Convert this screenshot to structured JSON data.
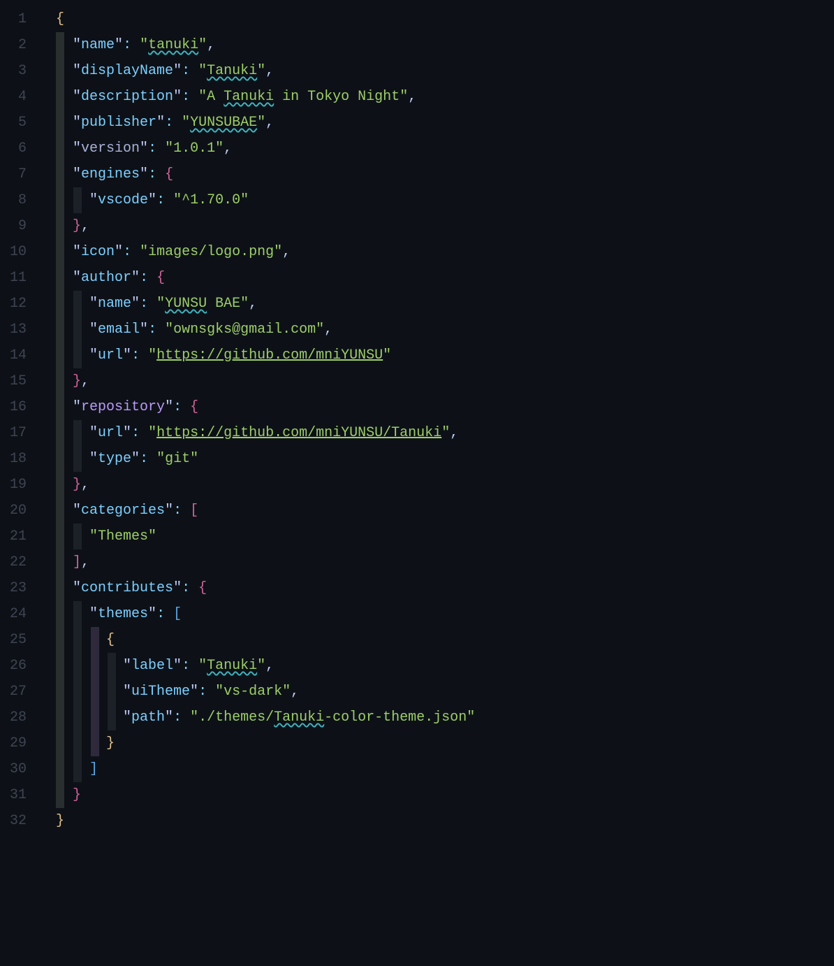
{
  "lineNumbers": [
    "1",
    "2",
    "3",
    "4",
    "5",
    "6",
    "7",
    "8",
    "9",
    "10",
    "11",
    "12",
    "13",
    "14",
    "15",
    "16",
    "17",
    "18",
    "19",
    "20",
    "21",
    "22",
    "23",
    "24",
    "25",
    "26",
    "27",
    "28",
    "29",
    "30",
    "31",
    "32"
  ],
  "code": {
    "name_key": "name",
    "name_val": "tanuki",
    "displayName_key": "displayName",
    "displayName_val": "Tanuki",
    "description_key": "description",
    "description_pre": "A ",
    "description_wavy": "Tanuki",
    "description_post": " in Tokyo Night",
    "publisher_key": "publisher",
    "publisher_val": "YUNSUBAE",
    "version_key": "version",
    "version_val": "1.0.1",
    "engines_key": "engines",
    "vscode_key": "vscode",
    "vscode_val": "^1.70.0",
    "icon_key": "icon",
    "icon_val": "images/logo.png",
    "author_key": "author",
    "author_name_key": "name",
    "author_name_pre": "YUNSU",
    "author_name_post": " BAE",
    "email_key": "email",
    "email_val": "ownsgks@gmail.com",
    "url_key": "url",
    "author_url_val": "https://github.com/mniYUNSU",
    "repository_key": "repository",
    "repo_url_val": "https://github.com/mniYUNSU/Tanuki",
    "type_key": "type",
    "type_val": "git",
    "categories_key": "categories",
    "categories_item": "Themes",
    "contributes_key": "contributes",
    "themes_key": "themes",
    "label_key": "label",
    "label_val": "Tanuki",
    "uiTheme_key": "uiTheme",
    "uiTheme_val": "vs-dark",
    "path_key": "path",
    "path_pre": "./themes/",
    "path_wavy": "Tanuki",
    "path_post": "-color-theme.json"
  }
}
